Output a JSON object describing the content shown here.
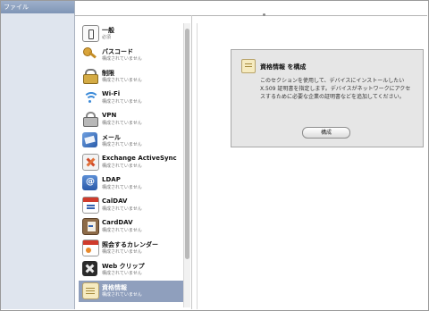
{
  "sidebar": {
    "header": "ファイル"
  },
  "payloads": [
    {
      "title": "一般",
      "status": "必須",
      "icon": "general-icon"
    },
    {
      "title": "パスコード",
      "status": "構成されていません",
      "icon": "key-icon"
    },
    {
      "title": "制限",
      "status": "構成されていません",
      "icon": "restrictions-icon"
    },
    {
      "title": "Wi-Fi",
      "status": "構成されていません",
      "icon": "wifi-icon"
    },
    {
      "title": "VPN",
      "status": "構成されていません",
      "icon": "lock-icon"
    },
    {
      "title": "メール",
      "status": "構成されていません",
      "icon": "mail-icon"
    },
    {
      "title": "Exchange ActiveSync",
      "status": "構成されていません",
      "icon": "exchange-icon"
    },
    {
      "title": "LDAP",
      "status": "構成されていません",
      "icon": "ldap-icon"
    },
    {
      "title": "CalDAV",
      "status": "構成されていません",
      "icon": "calendar-icon"
    },
    {
      "title": "CardDAV",
      "status": "構成されていません",
      "icon": "address-book-icon"
    },
    {
      "title": "照会するカレンダー",
      "status": "構成されていません",
      "icon": "subscribed-calendar-icon"
    },
    {
      "title": "Web クリップ",
      "status": "構成されていません",
      "icon": "web-clip-icon"
    },
    {
      "title": "資格情報",
      "status": "構成されていません",
      "icon": "credential-icon"
    }
  ],
  "panel": {
    "title": "資格情報 を構成",
    "description": "このセクションを使用して、デバイスにインストールしたいX.509 証明書を指定します。デバイスがネットワークにアクセスするために必要な企業の証明書などを追加してください。",
    "button": "構成"
  },
  "colors": {
    "selection": "#8f9fbd",
    "sidebar": "#dfe5ee",
    "panel": "#e6e6e6"
  }
}
